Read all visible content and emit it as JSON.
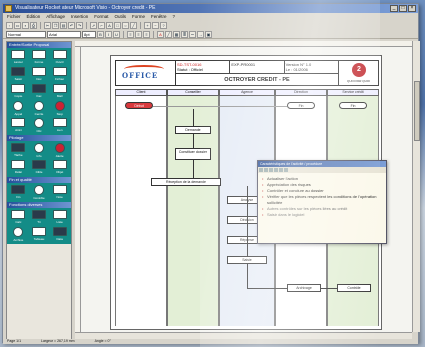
{
  "window": {
    "title": "Visualisateur Rocket ateur Microsoft Visio - Octroyer credit - PE"
  },
  "menu": [
    "Fichier",
    "Édition",
    "Affichage",
    "Insertion",
    "Format",
    "Outils",
    "Forme",
    "Fenêtre",
    "?"
  ],
  "toolbar": {
    "style_combo": "Normal",
    "font_combo": "Arial",
    "size_combo": "8pt"
  },
  "stencils": [
    {
      "title": "Entrée/Sortie Proposal",
      "theme": "dark",
      "shapes": [
        "Lancer",
        "Forme",
        "Ouvrir",
        "Saisir",
        "Doc",
        "Fichier",
        "Copie",
        "Fax",
        "Mail",
        "Appel",
        "Cercle",
        "Stop",
        "Arrêt",
        "Clic",
        "Lien"
      ]
    },
    {
      "title": "Pilotage",
      "theme": "dark",
      "shapes": [
        "Tâche",
        "Info",
        "Alerte",
        "Délai",
        "Cible",
        "Objet"
      ]
    },
    {
      "title": "Fin et qualité",
      "theme": "dark",
      "shapes": [
        "Fin",
        "Contrôle",
        "Note"
      ]
    },
    {
      "title": "Fonctions diverses",
      "theme": "dark",
      "shapes": [
        "Calc",
        "Tri",
        "Liste",
        "Archive",
        "Tableau",
        "Data"
      ]
    }
  ],
  "diagram": {
    "header": {
      "logo": "OFFICE",
      "ref": "SD-TST-0016",
      "id": "EXP-PR0001",
      "version": "Version N° 1.0",
      "status": "Statut : Officiel",
      "date": "Le : 01/2006",
      "title": "OCTROYER CREDIT - PE",
      "stop_caption": "QUOI PAR QUOI"
    },
    "lanes": [
      "Client",
      "Conseiller",
      "Agence",
      "Direction",
      "Service crédit"
    ],
    "nodes": [
      "Début",
      "Demande",
      "Réception de la demande",
      "Constituer dossier",
      "Analyse",
      "Décision",
      "Réponse",
      "Saisie",
      "Fin",
      "Archivage",
      "Contrôle",
      "Fin"
    ]
  },
  "dialog": {
    "title": "Caractéristiques de l'activité / procédure",
    "items": [
      {
        "text": "Actualiser l'action",
        "style": "normal"
      },
      {
        "text": "Appréciation des risques",
        "style": "normal"
      },
      {
        "text": "Contrôler et conclure au dossier",
        "style": "normal"
      },
      {
        "text": "Vérifier que les pièces respectent les conditions de l'opération sollicitée",
        "style": "normal"
      },
      {
        "text": "Autres contrôles sur les pièces liées au crédit",
        "style": "gray"
      },
      {
        "text": "Saisir dans le logiciel",
        "style": "gray"
      }
    ]
  },
  "status": {
    "page": "Page 1/1",
    "width": "Largeur = 267,19 mm",
    "angle": "Angle = 0°"
  }
}
